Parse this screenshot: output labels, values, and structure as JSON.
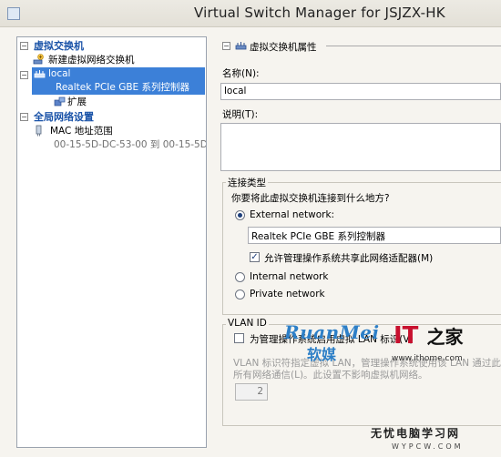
{
  "window": {
    "title": "Virtual Switch Manager for JSJZX-HK"
  },
  "tree": {
    "virtual_switches_header": "虚拟交换机",
    "new_switch": "新建虚拟网络交换机",
    "switch_name": "local",
    "switch_adapter": "Realtek PCIe GBE 系列控制器",
    "extensions": "扩展",
    "global_settings_header": "全局网络设置",
    "mac_range": "MAC 地址范围",
    "mac_range_value": "00-15-5D-DC-53-00 到 00-15-5D-..."
  },
  "properties": {
    "section_title": "虚拟交换机属性",
    "name_label": "名称(N):",
    "name_value": "local",
    "notes_label": "说明(T):",
    "notes_value": "",
    "connection_type_label": "连接类型",
    "connection_question": "你要将此虚拟交换机连接到什么地方?",
    "external_network": "External network:",
    "external_adapter": "Realtek PCIe GBE 系列控制器",
    "allow_mgmt_os": "允许管理操作系统共享此网络适配器(M)",
    "internal_network": "Internal network",
    "private_network": "Private network",
    "vlan_id_label": "VLAN ID",
    "vlan_enable": "为管理操作系统启用虚拟 LAN 标识(V)",
    "vlan_desc_line1": "VLAN 标识符指定虚拟 LAN，管理操作系统使用该 LAN 通过此网",
    "vlan_desc_line2": "所有网络通信(L)。此设置不影响虚拟机网络。",
    "vlan_value": "2"
  },
  "watermarks": {
    "ruanmei": "RuanMei",
    "ruanmei_cn": "软媒",
    "it": "IT",
    "it_cn": "之家",
    "ithome_url": "www.ithome.com",
    "wypcw": "无忧电脑学习网",
    "wypcw_url": "WYPCW.COM"
  },
  "colors": {
    "selection": "#3c80d8",
    "category_text": "#1a53a8"
  },
  "icons": {
    "new_switch": "network-add-icon",
    "switch": "network-switch-icon",
    "extensions": "extension-icon",
    "mac": "mac-address-icon"
  }
}
